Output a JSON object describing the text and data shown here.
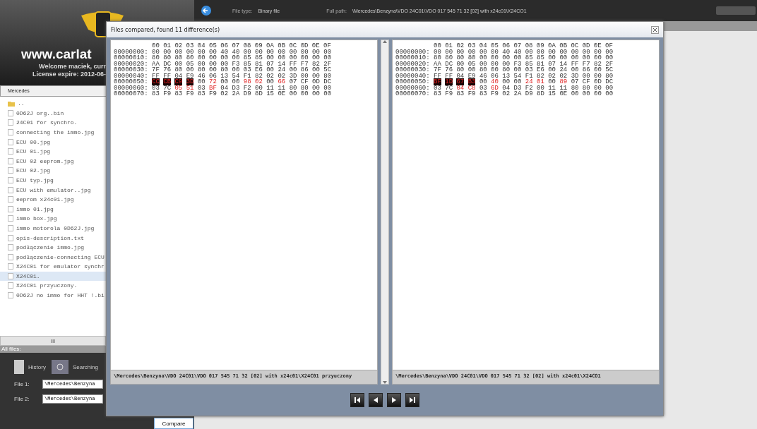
{
  "sidebar": {
    "site": "www.carlat",
    "welcome": "Welcome maciek, curr",
    "license": "License expire: 2012-06-",
    "folder": "Mercedes",
    "files": [
      {
        "name": "..",
        "kind": "folder",
        "selected": false
      },
      {
        "name": "0D62J org..bin",
        "kind": "file",
        "selected": false
      },
      {
        "name": "24C01 for synchro.",
        "kind": "file",
        "selected": false
      },
      {
        "name": "connecting the immo.jpg",
        "kind": "file",
        "selected": false
      },
      {
        "name": "ECU 00.jpg",
        "kind": "file",
        "selected": false
      },
      {
        "name": "ECU 01.jpg",
        "kind": "file",
        "selected": false
      },
      {
        "name": "ECU 02 eeprom.jpg",
        "kind": "file",
        "selected": false
      },
      {
        "name": "ECU 02.jpg",
        "kind": "file",
        "selected": false
      },
      {
        "name": "ECU typ.jpg",
        "kind": "file",
        "selected": false
      },
      {
        "name": "ECU with emulator..jpg",
        "kind": "file",
        "selected": false
      },
      {
        "name": "eeprom x24c01.jpg",
        "kind": "file",
        "selected": false
      },
      {
        "name": "immo 01.jpg",
        "kind": "file",
        "selected": false
      },
      {
        "name": "immo box.jpg",
        "kind": "file",
        "selected": false
      },
      {
        "name": "immo motorola 0D62J.jpg",
        "kind": "file",
        "selected": false
      },
      {
        "name": "opis-description.txt",
        "kind": "file",
        "selected": false
      },
      {
        "name": "podłączenie immo.jpg",
        "kind": "file",
        "selected": false
      },
      {
        "name": "podłączenie-connecting ECU",
        "kind": "file",
        "selected": false
      },
      {
        "name": "X24C01 for emulator synchr",
        "kind": "file",
        "selected": false
      },
      {
        "name": "X24C01.",
        "kind": "file",
        "selected": true
      },
      {
        "name": "X24C01 przyuczony.",
        "kind": "file",
        "selected": false
      },
      {
        "name": "0D62J no immo for HHT !.bi",
        "kind": "file",
        "selected": false
      }
    ],
    "scroll_label": "III",
    "all_files": "All files:",
    "history": "History",
    "searching": "Searching",
    "file1_label": "File 1:",
    "file1": "\\Mercedes\\Benzyna",
    "file2_label": "File 2:",
    "file2": "\\Mercedes\\Benzyna",
    "compare": "Compare"
  },
  "topbar": {
    "file_type_label": "File type:",
    "file_type": "Binary file",
    "full_path_label": "Full path:",
    "full_path": "\\Mercedes\\Benzyna\\VDO 24C01\\VDO 017 545 71 32 [02] with x24c01\\X24CO1"
  },
  "dialog": {
    "title": "Files compared, found 11 difference(s)",
    "left": {
      "header": [
        "00",
        "01",
        "02",
        "03",
        "04",
        "05",
        "06",
        "07",
        "08",
        "09",
        "0A",
        "0B",
        "0C",
        "0D",
        "0E",
        "0F"
      ],
      "path": "\\Mercedes\\Benzyna\\VDO 24C01\\VDO 017 545 71 32 [02] with x24c01\\X24C01 przyuczony",
      "rows": [
        {
          "address": "00000000:",
          "bytes": [
            "00",
            "00",
            "00",
            "00",
            "00",
            "00",
            "40",
            "40",
            "00",
            "00",
            "00",
            "00",
            "00",
            "00",
            "00",
            "00"
          ]
        },
        {
          "address": "00000010:",
          "bytes": [
            "80",
            "80",
            "80",
            "80",
            "00",
            "00",
            "00",
            "00",
            "85",
            "85",
            "00",
            "00",
            "00",
            "00",
            "00",
            "00"
          ]
        },
        {
          "address": "00000020:",
          "bytes": [
            "AA",
            "DC",
            "00",
            "05",
            "00",
            "00",
            "00",
            "F3",
            "85",
            "81",
            "07",
            "14",
            "FF",
            "F7",
            "82",
            "2F"
          ]
        },
        {
          "address": "00000030:",
          "bytes": [
            "7F",
            "76",
            "80",
            "00",
            "80",
            "00",
            "80",
            "00",
            "03",
            "E6",
            "00",
            "24",
            "00",
            "86",
            "00",
            "5C"
          ]
        },
        {
          "address": "00000040:",
          "bytes": [
            "FF",
            "FF",
            "04",
            "E9",
            "46",
            "06",
            "13",
            "54",
            "F1",
            "82",
            "02",
            "02",
            "3D",
            "00",
            "00",
            "80"
          ]
        },
        {
          "address": "00000050:",
          "bytes": [
            "CC",
            "CB",
            "C9",
            "3D",
            "00",
            "72",
            "00",
            "00",
            "98",
            "02",
            "00",
            "66",
            "07",
            "CF",
            "0D",
            "DC"
          ],
          "diff": [
            true,
            true,
            true,
            true,
            false,
            true,
            false,
            false,
            true,
            true,
            false,
            true,
            false,
            false,
            false,
            false
          ],
          "current": [
            true,
            true,
            true,
            true,
            false,
            false,
            false,
            false,
            false,
            false,
            false,
            false,
            false,
            false,
            false,
            false
          ]
        },
        {
          "address": "00000060:",
          "bytes": [
            "03",
            "7C",
            "05",
            "51",
            "03",
            "BF",
            "04",
            "D3",
            "F2",
            "00",
            "11",
            "11",
            "80",
            "80",
            "00",
            "00"
          ],
          "diff": [
            false,
            false,
            true,
            true,
            false,
            true,
            false,
            false,
            false,
            false,
            false,
            false,
            false,
            false,
            false,
            false
          ]
        },
        {
          "address": "00000070:",
          "bytes": [
            "83",
            "F9",
            "83",
            "F9",
            "83",
            "F9",
            "02",
            "2A",
            "D9",
            "8D",
            "15",
            "0E",
            "00",
            "00",
            "00",
            "00"
          ]
        }
      ]
    },
    "right": {
      "header": [
        "00",
        "01",
        "02",
        "03",
        "04",
        "05",
        "06",
        "07",
        "08",
        "09",
        "0A",
        "0B",
        "0C",
        "0D",
        "0E",
        "0F"
      ],
      "path": "\\Mercedes\\Benzyna\\VDO 24C01\\VDO 017 545 71 32 [02] with x24c01\\X24CO1",
      "rows": [
        {
          "address": "00000000:",
          "bytes": [
            "00",
            "00",
            "00",
            "00",
            "00",
            "00",
            "40",
            "40",
            "00",
            "00",
            "00",
            "00",
            "00",
            "00",
            "00",
            "00"
          ]
        },
        {
          "address": "00000010:",
          "bytes": [
            "80",
            "80",
            "80",
            "80",
            "00",
            "00",
            "00",
            "00",
            "85",
            "85",
            "00",
            "00",
            "00",
            "00",
            "00",
            "00"
          ]
        },
        {
          "address": "00000020:",
          "bytes": [
            "AA",
            "DC",
            "00",
            "05",
            "00",
            "00",
            "00",
            "F3",
            "85",
            "81",
            "07",
            "14",
            "FF",
            "F7",
            "82",
            "2F"
          ]
        },
        {
          "address": "00000030:",
          "bytes": [
            "7F",
            "76",
            "80",
            "00",
            "80",
            "00",
            "80",
            "00",
            "03",
            "E6",
            "00",
            "24",
            "00",
            "86",
            "00",
            "5C"
          ]
        },
        {
          "address": "00000040:",
          "bytes": [
            "FF",
            "FF",
            "04",
            "E9",
            "46",
            "06",
            "13",
            "54",
            "F1",
            "82",
            "02",
            "02",
            "3D",
            "00",
            "00",
            "80"
          ]
        },
        {
          "address": "00000050:",
          "bytes": [
            "BF",
            "1D",
            "67",
            "B3",
            "00",
            "40",
            "00",
            "00",
            "24",
            "01",
            "00",
            "89",
            "07",
            "CF",
            "0D",
            "DC"
          ],
          "diff": [
            true,
            true,
            true,
            true,
            false,
            true,
            false,
            false,
            true,
            true,
            false,
            true,
            false,
            false,
            false,
            false
          ],
          "current": [
            true,
            true,
            true,
            true,
            false,
            false,
            false,
            false,
            false,
            false,
            false,
            false,
            false,
            false,
            false,
            false
          ]
        },
        {
          "address": "00000060:",
          "bytes": [
            "03",
            "7C",
            "04",
            "C8",
            "03",
            "6D",
            "04",
            "D3",
            "F2",
            "00",
            "11",
            "11",
            "80",
            "80",
            "00",
            "00"
          ],
          "diff": [
            false,
            false,
            true,
            true,
            false,
            true,
            false,
            false,
            false,
            false,
            false,
            false,
            false,
            false,
            false,
            false
          ]
        },
        {
          "address": "00000070:",
          "bytes": [
            "83",
            "F9",
            "83",
            "F9",
            "83",
            "F9",
            "02",
            "2A",
            "D9",
            "8D",
            "15",
            "0E",
            "00",
            "00",
            "00",
            "00"
          ]
        }
      ]
    }
  }
}
